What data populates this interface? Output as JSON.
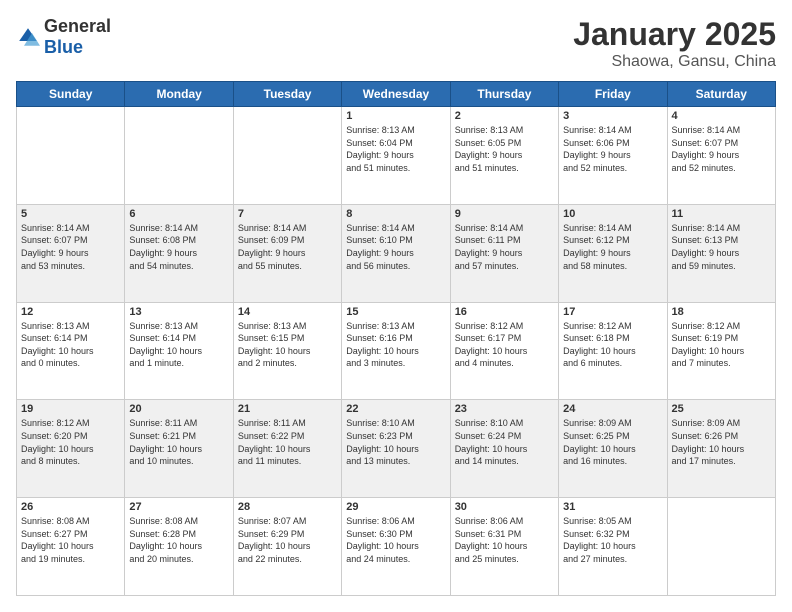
{
  "logo": {
    "general": "General",
    "blue": "Blue"
  },
  "header": {
    "month_year": "January 2025",
    "location": "Shaowa, Gansu, China"
  },
  "days_of_week": [
    "Sunday",
    "Monday",
    "Tuesday",
    "Wednesday",
    "Thursday",
    "Friday",
    "Saturday"
  ],
  "weeks": [
    {
      "shaded": false,
      "days": [
        {
          "num": "",
          "text": ""
        },
        {
          "num": "",
          "text": ""
        },
        {
          "num": "",
          "text": ""
        },
        {
          "num": "1",
          "text": "Sunrise: 8:13 AM\nSunset: 6:04 PM\nDaylight: 9 hours\nand 51 minutes."
        },
        {
          "num": "2",
          "text": "Sunrise: 8:13 AM\nSunset: 6:05 PM\nDaylight: 9 hours\nand 51 minutes."
        },
        {
          "num": "3",
          "text": "Sunrise: 8:14 AM\nSunset: 6:06 PM\nDaylight: 9 hours\nand 52 minutes."
        },
        {
          "num": "4",
          "text": "Sunrise: 8:14 AM\nSunset: 6:07 PM\nDaylight: 9 hours\nand 52 minutes."
        }
      ]
    },
    {
      "shaded": true,
      "days": [
        {
          "num": "5",
          "text": "Sunrise: 8:14 AM\nSunset: 6:07 PM\nDaylight: 9 hours\nand 53 minutes."
        },
        {
          "num": "6",
          "text": "Sunrise: 8:14 AM\nSunset: 6:08 PM\nDaylight: 9 hours\nand 54 minutes."
        },
        {
          "num": "7",
          "text": "Sunrise: 8:14 AM\nSunset: 6:09 PM\nDaylight: 9 hours\nand 55 minutes."
        },
        {
          "num": "8",
          "text": "Sunrise: 8:14 AM\nSunset: 6:10 PM\nDaylight: 9 hours\nand 56 minutes."
        },
        {
          "num": "9",
          "text": "Sunrise: 8:14 AM\nSunset: 6:11 PM\nDaylight: 9 hours\nand 57 minutes."
        },
        {
          "num": "10",
          "text": "Sunrise: 8:14 AM\nSunset: 6:12 PM\nDaylight: 9 hours\nand 58 minutes."
        },
        {
          "num": "11",
          "text": "Sunrise: 8:14 AM\nSunset: 6:13 PM\nDaylight: 9 hours\nand 59 minutes."
        }
      ]
    },
    {
      "shaded": false,
      "days": [
        {
          "num": "12",
          "text": "Sunrise: 8:13 AM\nSunset: 6:14 PM\nDaylight: 10 hours\nand 0 minutes."
        },
        {
          "num": "13",
          "text": "Sunrise: 8:13 AM\nSunset: 6:14 PM\nDaylight: 10 hours\nand 1 minute."
        },
        {
          "num": "14",
          "text": "Sunrise: 8:13 AM\nSunset: 6:15 PM\nDaylight: 10 hours\nand 2 minutes."
        },
        {
          "num": "15",
          "text": "Sunrise: 8:13 AM\nSunset: 6:16 PM\nDaylight: 10 hours\nand 3 minutes."
        },
        {
          "num": "16",
          "text": "Sunrise: 8:12 AM\nSunset: 6:17 PM\nDaylight: 10 hours\nand 4 minutes."
        },
        {
          "num": "17",
          "text": "Sunrise: 8:12 AM\nSunset: 6:18 PM\nDaylight: 10 hours\nand 6 minutes."
        },
        {
          "num": "18",
          "text": "Sunrise: 8:12 AM\nSunset: 6:19 PM\nDaylight: 10 hours\nand 7 minutes."
        }
      ]
    },
    {
      "shaded": true,
      "days": [
        {
          "num": "19",
          "text": "Sunrise: 8:12 AM\nSunset: 6:20 PM\nDaylight: 10 hours\nand 8 minutes."
        },
        {
          "num": "20",
          "text": "Sunrise: 8:11 AM\nSunset: 6:21 PM\nDaylight: 10 hours\nand 10 minutes."
        },
        {
          "num": "21",
          "text": "Sunrise: 8:11 AM\nSunset: 6:22 PM\nDaylight: 10 hours\nand 11 minutes."
        },
        {
          "num": "22",
          "text": "Sunrise: 8:10 AM\nSunset: 6:23 PM\nDaylight: 10 hours\nand 13 minutes."
        },
        {
          "num": "23",
          "text": "Sunrise: 8:10 AM\nSunset: 6:24 PM\nDaylight: 10 hours\nand 14 minutes."
        },
        {
          "num": "24",
          "text": "Sunrise: 8:09 AM\nSunset: 6:25 PM\nDaylight: 10 hours\nand 16 minutes."
        },
        {
          "num": "25",
          "text": "Sunrise: 8:09 AM\nSunset: 6:26 PM\nDaylight: 10 hours\nand 17 minutes."
        }
      ]
    },
    {
      "shaded": false,
      "days": [
        {
          "num": "26",
          "text": "Sunrise: 8:08 AM\nSunset: 6:27 PM\nDaylight: 10 hours\nand 19 minutes."
        },
        {
          "num": "27",
          "text": "Sunrise: 8:08 AM\nSunset: 6:28 PM\nDaylight: 10 hours\nand 20 minutes."
        },
        {
          "num": "28",
          "text": "Sunrise: 8:07 AM\nSunset: 6:29 PM\nDaylight: 10 hours\nand 22 minutes."
        },
        {
          "num": "29",
          "text": "Sunrise: 8:06 AM\nSunset: 6:30 PM\nDaylight: 10 hours\nand 24 minutes."
        },
        {
          "num": "30",
          "text": "Sunrise: 8:06 AM\nSunset: 6:31 PM\nDaylight: 10 hours\nand 25 minutes."
        },
        {
          "num": "31",
          "text": "Sunrise: 8:05 AM\nSunset: 6:32 PM\nDaylight: 10 hours\nand 27 minutes."
        },
        {
          "num": "",
          "text": ""
        }
      ]
    }
  ]
}
